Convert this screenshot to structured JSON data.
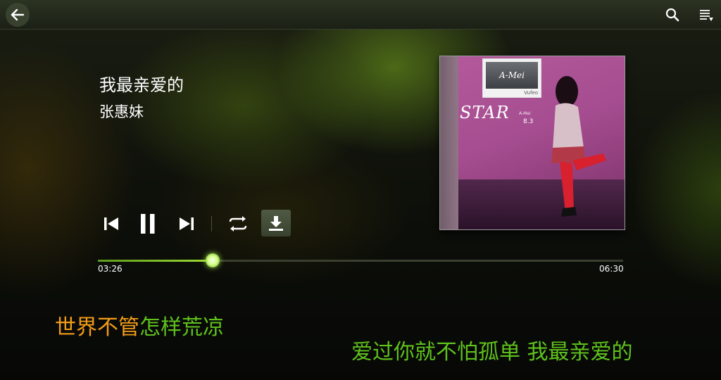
{
  "topbar": {
    "back_icon": "arrow-left-icon",
    "search_icon": "search-icon",
    "playlist_icon": "playlist-icon"
  },
  "track": {
    "title": "我最亲爱的",
    "artist": "张惠妹"
  },
  "album_art": {
    "logo_text": "A-Mei",
    "logo_subtext": "Vufeo",
    "cover_title": "STAR",
    "cover_small_text": "A-Mei",
    "cover_date": "8.3"
  },
  "controls": {
    "previous_icon": "skip-previous-icon",
    "pause_icon": "pause-icon",
    "next_icon": "skip-next-icon",
    "repeat_icon": "repeat-icon",
    "download_icon": "download-icon"
  },
  "progress": {
    "current_time": "03:26",
    "total_time": "06:30",
    "fraction": 0.218
  },
  "lyrics": {
    "current_line_sung": "世界不管",
    "current_line_unsung": "怎样荒凉",
    "next_line": "爱过你就不怕孤单 我最亲爱的"
  },
  "colors": {
    "accent_green": "#5fc21c",
    "lyric_highlight": "#f39c1a"
  }
}
